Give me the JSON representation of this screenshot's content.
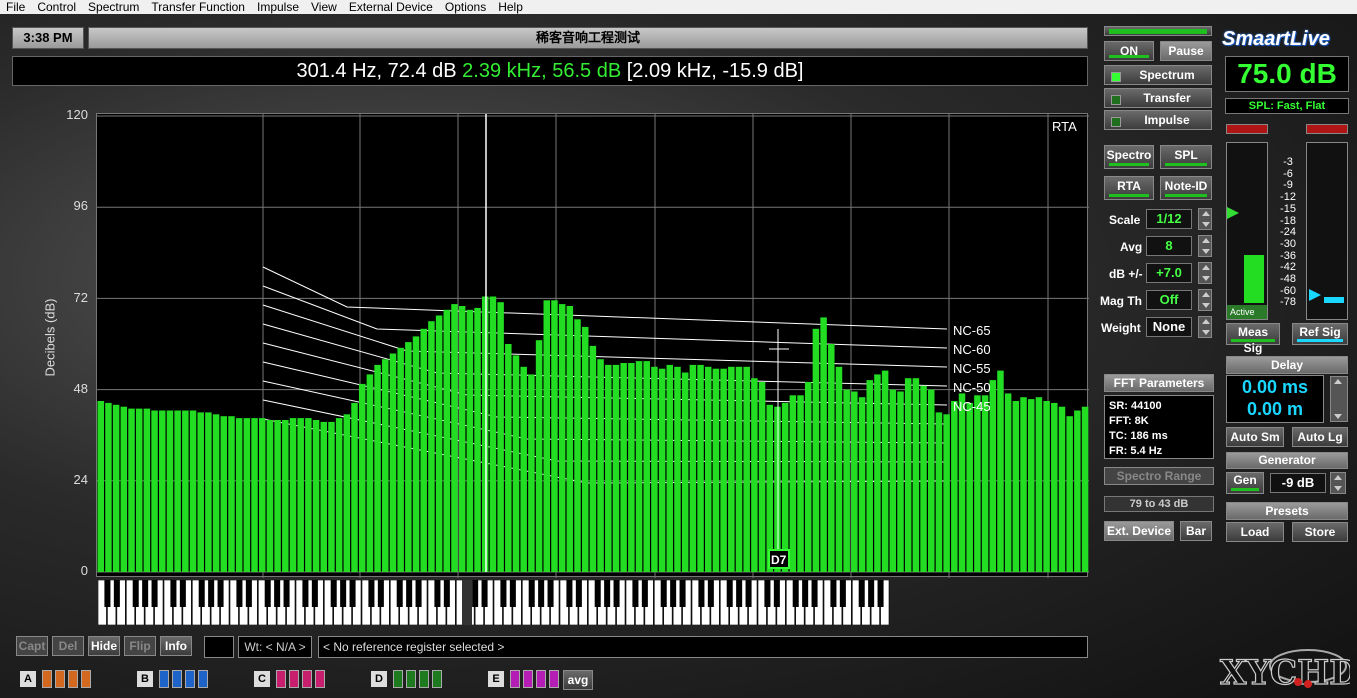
{
  "menu": [
    "File",
    "Control",
    "Spectrum",
    "Transfer Function",
    "Impulse",
    "View",
    "External Device",
    "Options",
    "Help"
  ],
  "header": {
    "time": "3:38 PM",
    "title": "稀客音响工程测试",
    "readout_white": "301.4 Hz, 72.4 dB",
    "readout_green": "2.39 kHz, 56.5 dB",
    "readout_bracket": "[2.09 kHz, -15.9 dB]"
  },
  "plot": {
    "mode_label": "RTA",
    "ylabel": "Decibels (dB)",
    "yticks": [
      "120",
      "96",
      "72",
      "48",
      "24",
      "0"
    ],
    "nc_labels": [
      "NC-65",
      "NC-60",
      "NC-55",
      "NC-50",
      "NC-45"
    ],
    "note_marker": "D7"
  },
  "chart_data": {
    "type": "bar",
    "title": "RTA",
    "ylabel": "Decibels (dB)",
    "ylim": [
      0,
      120
    ],
    "grid": true,
    "values": [
      45,
      44.5,
      44,
      43.5,
      43,
      43,
      43,
      42.5,
      42.5,
      42.5,
      42.5,
      42.5,
      42.5,
      42,
      42,
      41.5,
      41,
      41,
      40.5,
      40.5,
      40.5,
      40.5,
      40,
      40,
      40,
      40.5,
      40.5,
      40.5,
      40,
      39.5,
      39.5,
      40.5,
      41.5,
      44.5,
      49.5,
      52,
      54.5,
      56,
      57.5,
      59,
      60.5,
      62,
      64,
      66,
      67.5,
      69,
      70.5,
      70,
      69,
      69.5,
      72.5,
      72.5,
      71,
      60,
      57,
      54,
      52,
      61,
      71.5,
      71.5,
      70.5,
      70,
      66.5,
      64.5,
      59.5,
      56,
      54.5,
      54.5,
      55,
      55,
      55.5,
      55.5,
      54,
      53.5,
      54.5,
      54,
      52.5,
      54.5,
      54.5,
      54,
      53.5,
      53.5,
      54,
      54,
      54,
      51,
      50,
      44,
      43.5,
      44.5,
      46.5,
      46.5,
      50,
      64,
      67,
      60,
      54,
      48,
      47.5,
      46,
      50.5,
      52,
      53,
      48,
      47.5,
      51,
      51,
      49,
      48,
      42,
      41.5,
      45,
      47,
      44.5,
      46.5,
      46.5,
      50.5,
      53,
      47,
      45,
      46,
      45.5,
      46,
      45,
      44.5,
      43.5,
      41,
      42.5,
      43.5
    ]
  },
  "right": {
    "on": "ON",
    "pause": "Pause",
    "spectrum": "Spectrum",
    "transfer": "Transfer",
    "impulse": "Impulse",
    "spectro": "Spectro",
    "spl": "SPL",
    "rta": "RTA",
    "note_id": "Note-ID",
    "scale_label": "Scale",
    "scale_val": "1/12",
    "avg_label": "Avg",
    "avg_val": "8",
    "db_label": "dB +/-",
    "db_val": "+7.0",
    "magth_label": "Mag Th",
    "magth_val": "Off",
    "weight_label": "Weight",
    "weight_val": "None",
    "fft_title": "FFT Parameters",
    "fft_sr": "SR: 44100",
    "fft_fft": "FFT: 8K",
    "fft_tc": "TC: 186 ms",
    "fft_fr": "FR: 5.4 Hz",
    "spectro_range": "Spectro Range",
    "range_val": "79 to 43 dB",
    "ext_device": "Ext. Device",
    "bar": "Bar",
    "logo": "SmaartLive",
    "spl_value": "75.0 dB",
    "spl_mode": "SPL: Fast, Flat",
    "meter_scale": [
      "-3",
      "-6",
      "-9",
      "-12",
      "-15",
      "-18",
      "-24",
      "-30",
      "-36",
      "-42",
      "-48",
      "-60",
      "-78"
    ],
    "meter_active": "Active",
    "meas_sig": "Meas Sig",
    "ref_sig": "Ref Sig",
    "delay_title": "Delay",
    "delay_ms": "0.00 ms",
    "delay_m": "0.00 m",
    "auto_sm": "Auto Sm",
    "auto_lg": "Auto Lg",
    "generator": "Generator",
    "gen": "Gen",
    "gen_val": "-9 dB",
    "presets": "Presets",
    "load": "Load",
    "store": "Store",
    "meter_left_level": 0.3,
    "meter_right_level": 0.03
  },
  "bottom": {
    "capt": "Capt",
    "del": "Del",
    "hide": "Hide",
    "flip": "Flip",
    "info": "Info",
    "wt": "Wt: < N/A >",
    "ref": "< No reference register selected >",
    "registers": [
      "A",
      "B",
      "C",
      "D",
      "E"
    ],
    "avg": "avg",
    "register_colors": [
      "#d2691e",
      "#1e64c8",
      "#c81e6e",
      "#1e7a1e",
      "#b41eb4"
    ]
  },
  "colors": {
    "bar_green": "#22dd22",
    "accent_green": "#33ee33",
    "cyan": "#19d7ff"
  }
}
